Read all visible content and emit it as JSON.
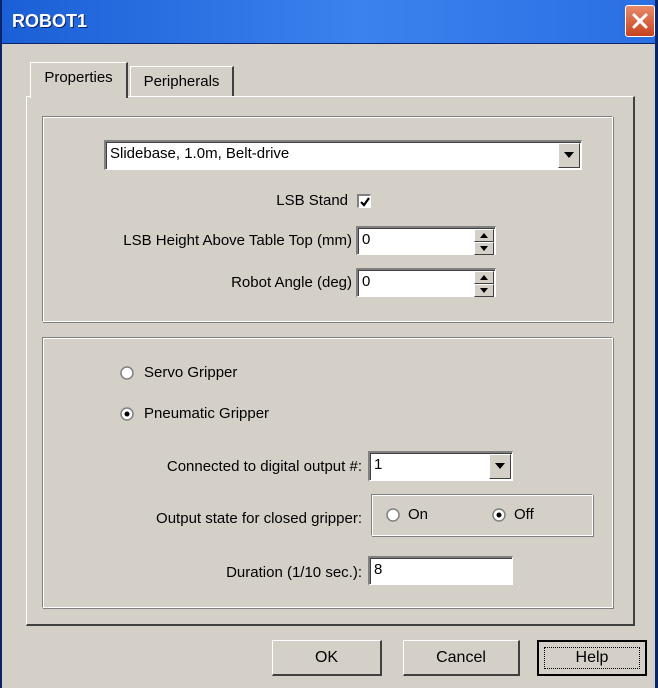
{
  "window": {
    "title": "ROBOT1"
  },
  "tabs": [
    {
      "label": "Properties",
      "active": true
    },
    {
      "label": "Peripherals",
      "active": false
    }
  ],
  "robot": {
    "base_select_value": "Slidebase, 1.0m, Belt-drive",
    "lsb_stand_label": "LSB Stand",
    "lsb_stand_checked": true,
    "lsb_height_label": "LSB Height Above Table Top (mm)",
    "lsb_height_value": "0",
    "robot_angle_label": "Robot Angle (deg)",
    "robot_angle_value": "0"
  },
  "gripper": {
    "servo_label": "Servo Gripper",
    "servo_selected": false,
    "pneumatic_label": "Pneumatic Gripper",
    "pneumatic_selected": true,
    "digital_output_label": "Connected to digital output #:",
    "digital_output_value": "1",
    "output_state_label": "Output state for closed gripper:",
    "state_on_label": "On",
    "state_off_label": "Off",
    "state_selected": "Off",
    "duration_label": "Duration (1/10 sec.):",
    "duration_value": "8"
  },
  "buttons": {
    "ok": "OK",
    "cancel": "Cancel",
    "help": "Help"
  },
  "colors": {
    "face": "#d4d0c8",
    "title_bar": "#2a6fe3",
    "close": "#c7431f"
  }
}
